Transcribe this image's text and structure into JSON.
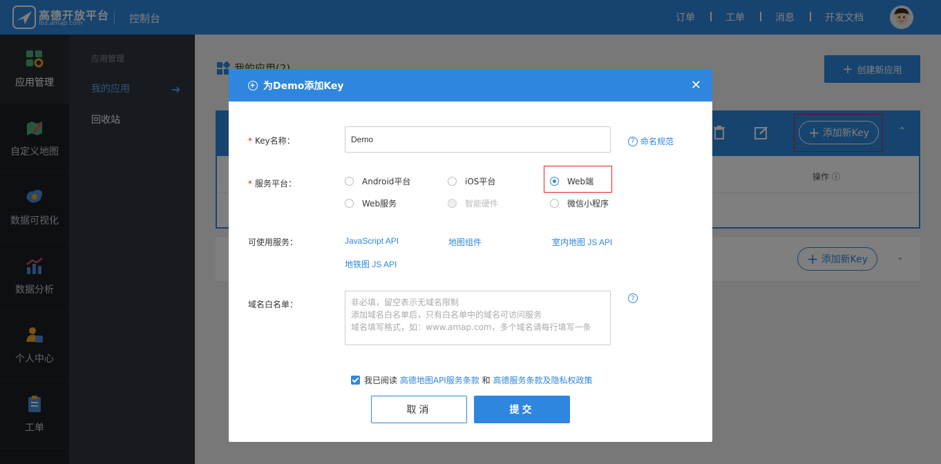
{
  "topbar": {
    "brand": "高德开放平台",
    "brand_sub": "lbs.amap.com",
    "console": "控制台",
    "nav": [
      "订单",
      "工单",
      "消息",
      "开发文档"
    ]
  },
  "rail": [
    {
      "label": "应用管理",
      "icon": "apps-gear-icon"
    },
    {
      "label": "自定义地图",
      "icon": "map-brush-icon"
    },
    {
      "label": "数据可视化",
      "icon": "china-map-icon"
    },
    {
      "label": "数据分析",
      "icon": "bar-chart-icon"
    },
    {
      "label": "个人中心",
      "icon": "user-card-icon"
    },
    {
      "label": "工单",
      "icon": "clipboard-icon"
    }
  ],
  "subside": {
    "heading": "应用管理",
    "items": [
      "我的应用",
      "回收站"
    ]
  },
  "main": {
    "title": "我的应用(2)",
    "create_button": "创建新应用",
    "ops_label": "操作",
    "add_key": "添加新Key"
  },
  "modal": {
    "title": "为Demo添加Key",
    "key_name_label": "Key名称：",
    "key_name_value": "Demo",
    "naming_rules": "命名规范",
    "platform_label": "服务平台：",
    "platforms": [
      {
        "label": "Android平台",
        "state": "unchecked"
      },
      {
        "label": "iOS平台",
        "state": "unchecked"
      },
      {
        "label": "Web端",
        "state": "checked"
      },
      {
        "label": "Web服务",
        "state": "unchecked"
      },
      {
        "label": "智能硬件",
        "state": "disabled"
      },
      {
        "label": "微信小程序",
        "state": "unchecked"
      }
    ],
    "services_label": "可使用服务：",
    "services": [
      "JavaScript API",
      "地图组件",
      "室内地图 JS API",
      "地铁图 JS API"
    ],
    "whitelist_label": "域名白名单：",
    "whitelist_placeholder": [
      "非必填，留空表示无域名限制",
      "添加域名白名单后，只有白名单中的域名可访问服务",
      "域名填写格式，如：www.amap.com，多个域名请每行填写一条"
    ],
    "agree_prefix": "我已阅读",
    "agree_link1": "高德地图API服务条款",
    "agree_and": "和",
    "agree_link2": "高德服务条款及隐私权政策",
    "cancel": "取消",
    "submit": "提交"
  },
  "colors": {
    "primary": "#2e86de",
    "highlight": "#e02020",
    "rail_bg": "#1a1f25",
    "subside_bg": "#2f353d"
  }
}
